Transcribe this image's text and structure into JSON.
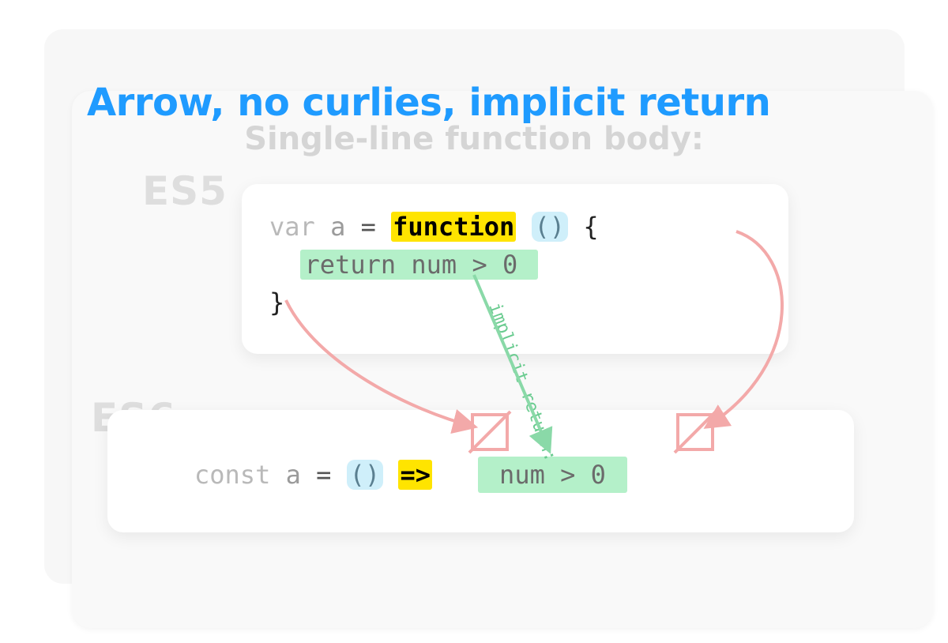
{
  "title": "Arrow, no curlies, implicit return",
  "subtitle": "Single-line function body:",
  "labels": {
    "es5": "ES5",
    "es6": "ES6"
  },
  "es5": {
    "kw_var": "var",
    "id": "a",
    "eq": "=",
    "kw_fn": "function",
    "paren": "()",
    "brace_open": "{",
    "return_line": "return num > 0 ",
    "brace_close": "}"
  },
  "es6": {
    "kw_const": "const",
    "id": "a",
    "eq": "=",
    "paren": "()",
    "arrow": "=>",
    "expr": " num > 0 "
  },
  "annotation": "implicit return:"
}
